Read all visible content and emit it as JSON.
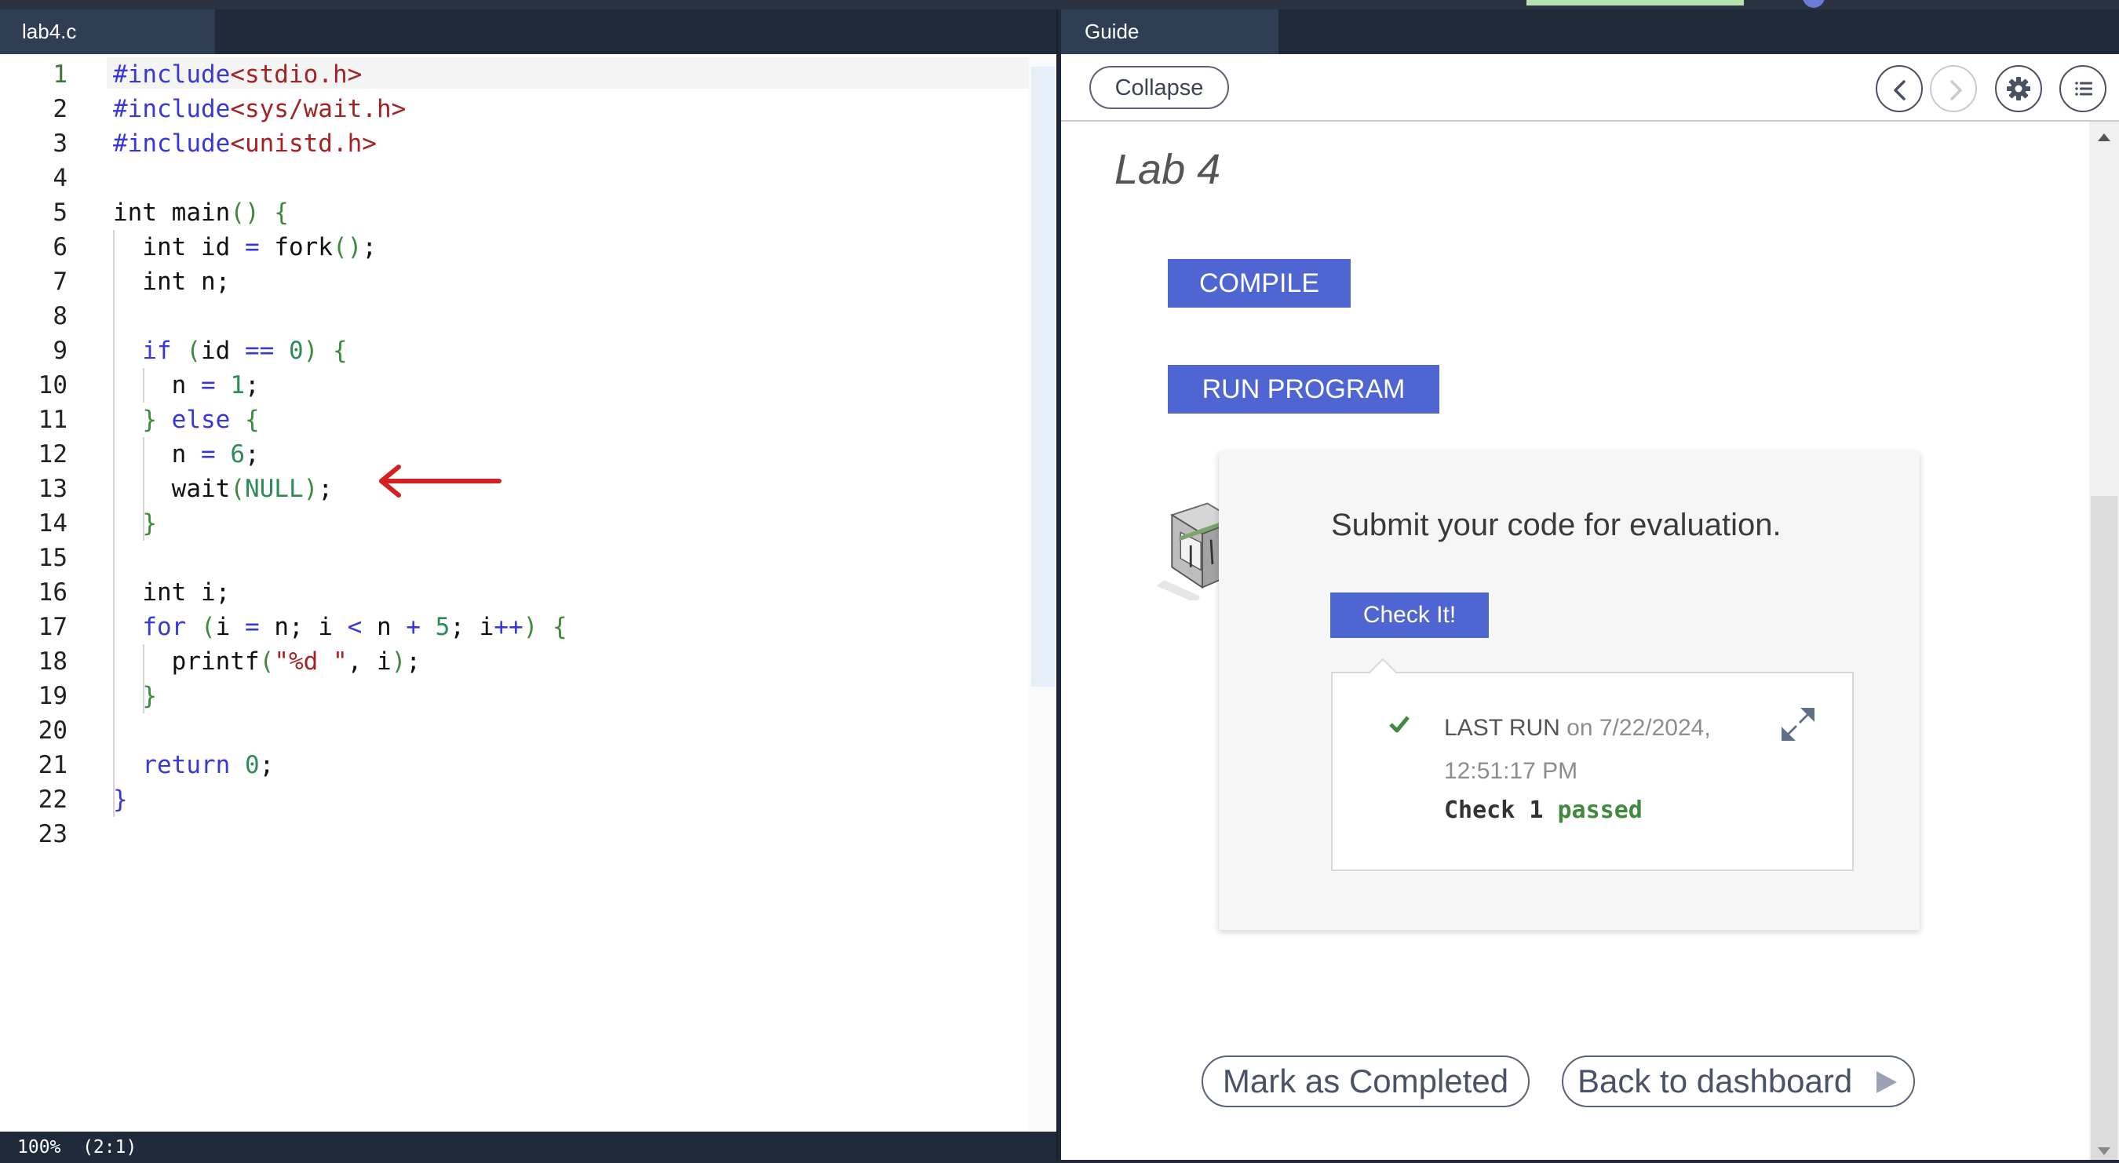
{
  "editor": {
    "tab_label": "lab4.c",
    "status": "100%  (2:1)",
    "lines": [
      {
        "n": "1",
        "segs": [
          [
            "pp",
            "#include"
          ],
          [
            "str",
            "<stdio.h>"
          ]
        ]
      },
      {
        "n": "2",
        "segs": [
          [
            "pp",
            "#include"
          ],
          [
            "str",
            "<sys/wait.h>"
          ]
        ]
      },
      {
        "n": "3",
        "segs": [
          [
            "pp",
            "#include"
          ],
          [
            "str",
            "<unistd.h>"
          ]
        ]
      },
      {
        "n": "4",
        "segs": []
      },
      {
        "n": "5",
        "segs": [
          [
            "",
            "int main"
          ],
          [
            "br",
            "() {"
          ]
        ]
      },
      {
        "n": "6",
        "segs": [
          [
            "",
            "  int id "
          ],
          [
            "op",
            "="
          ],
          [
            "",
            " fork"
          ],
          [
            "br",
            "()"
          ],
          [
            "",
            ";"
          ]
        ]
      },
      {
        "n": "7",
        "segs": [
          [
            "",
            "  int n;"
          ]
        ]
      },
      {
        "n": "8",
        "segs": []
      },
      {
        "n": "9",
        "segs": [
          [
            "kw",
            "  if"
          ],
          [
            "",
            " "
          ],
          [
            "br",
            "("
          ],
          [
            "",
            "id "
          ],
          [
            "op",
            "=="
          ],
          [
            "",
            " "
          ],
          [
            "num",
            "0"
          ],
          [
            "br",
            ") {"
          ]
        ]
      },
      {
        "n": "10",
        "segs": [
          [
            "",
            "    n "
          ],
          [
            "op",
            "="
          ],
          [
            "",
            " "
          ],
          [
            "num",
            "1"
          ],
          [
            "",
            ";"
          ]
        ]
      },
      {
        "n": "11",
        "segs": [
          [
            "br",
            "  }"
          ],
          [
            "",
            " "
          ],
          [
            "kw",
            "else"
          ],
          [
            "",
            " "
          ],
          [
            "br",
            "{"
          ]
        ]
      },
      {
        "n": "12",
        "segs": [
          [
            "",
            "    n "
          ],
          [
            "op",
            "="
          ],
          [
            "",
            " "
          ],
          [
            "num",
            "6"
          ],
          [
            "",
            ";"
          ]
        ]
      },
      {
        "n": "13",
        "segs": [
          [
            "",
            "    wait"
          ],
          [
            "br",
            "("
          ],
          [
            "num",
            "NULL"
          ],
          [
            "br",
            ")"
          ],
          [
            "",
            ";"
          ]
        ]
      },
      {
        "n": "14",
        "segs": [
          [
            "br",
            "  }"
          ]
        ]
      },
      {
        "n": "15",
        "segs": []
      },
      {
        "n": "16",
        "segs": [
          [
            "",
            "  int i;"
          ]
        ]
      },
      {
        "n": "17",
        "segs": [
          [
            "kw",
            "  for"
          ],
          [
            "",
            " "
          ],
          [
            "br",
            "("
          ],
          [
            "",
            "i "
          ],
          [
            "op",
            "="
          ],
          [
            "",
            " n; i "
          ],
          [
            "op",
            "<"
          ],
          [
            "",
            " n "
          ],
          [
            "op",
            "+"
          ],
          [
            "",
            " "
          ],
          [
            "num",
            "5"
          ],
          [
            "",
            "; i"
          ],
          [
            "op",
            "++"
          ],
          [
            "br",
            ") {"
          ]
        ]
      },
      {
        "n": "18",
        "segs": [
          [
            "",
            "    printf"
          ],
          [
            "br",
            "("
          ],
          [
            "str",
            "\"%d \""
          ],
          [
            "",
            ", i"
          ],
          [
            "br",
            ")"
          ],
          [
            "",
            ";"
          ]
        ]
      },
      {
        "n": "19",
        "segs": [
          [
            "br",
            "  }"
          ]
        ]
      },
      {
        "n": "20",
        "segs": []
      },
      {
        "n": "21",
        "segs": [
          [
            "kw",
            "  return"
          ],
          [
            "",
            " "
          ],
          [
            "num",
            "0"
          ],
          [
            "",
            ";"
          ]
        ]
      },
      {
        "n": "22",
        "segs": [
          [
            "kw",
            "}"
          ]
        ]
      },
      {
        "n": "23",
        "segs": []
      }
    ],
    "annotation": "red-arrow-icon"
  },
  "guide": {
    "tab_label": "Guide",
    "collapse_label": "Collapse",
    "title": "Lab 4",
    "compile_label": "COMPILE",
    "run_label": "RUN PROGRAM",
    "submit_text": "Submit your code for evaluation.",
    "check_label": "Check It!",
    "last_run_label": "LAST RUN",
    "last_run_on": "on 7/22/2024,",
    "last_run_time": "12:51:17 PM",
    "check_result_prefix": "Check 1 ",
    "check_result_status": "passed",
    "mark_completed_label": "Mark as Completed",
    "back_label": "Back to dashboard",
    "colors": {
      "accent": "#4f66d2",
      "pass": "#3f8a3f",
      "arrow": "#d42020"
    }
  }
}
